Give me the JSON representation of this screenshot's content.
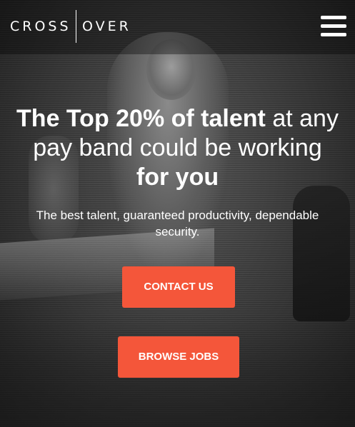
{
  "header": {
    "logo": {
      "part1": "CROSS",
      "part2": "OVER"
    },
    "menu_icon": "hamburger-menu-icon"
  },
  "hero": {
    "headline": {
      "bold1": "The Top 20% of talent",
      "light1": " at any pay band could be working ",
      "bold2": "for you"
    },
    "subtitle": "The best talent, guaranteed productivity, dependable security.",
    "contact_button": "CONTACT US",
    "browse_jobs_button": "BROWSE JOBS"
  },
  "colors": {
    "accent": "#f4563a",
    "text": "#ffffff"
  }
}
